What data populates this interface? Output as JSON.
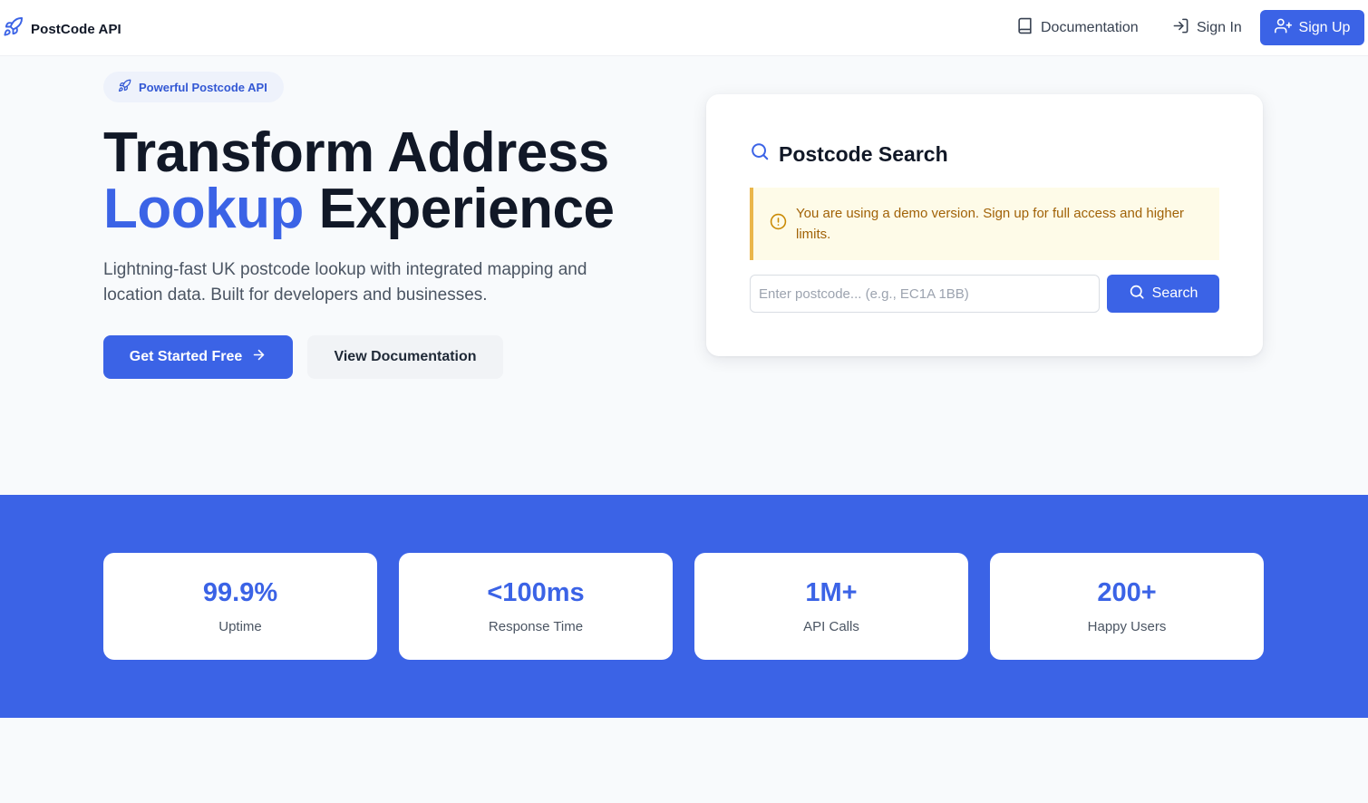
{
  "nav": {
    "brand": "PostCode API",
    "documentation": "Documentation",
    "sign_in": "Sign In",
    "sign_up": "Sign Up"
  },
  "hero": {
    "badge": "Powerful Postcode API",
    "headline_line1": "Transform Address",
    "headline_accent": "Lookup",
    "headline_rest": "Experience",
    "subtext": "Lightning-fast UK postcode lookup with integrated mapping and location data. Built for developers and businesses.",
    "primary_button": "Get Started Free",
    "secondary_button": "View Documentation"
  },
  "search_card": {
    "title": "Postcode Search",
    "alert": "You are using a demo version. Sign up for full access and higher limits.",
    "input_value": "",
    "input_placeholder": "Enter postcode... (e.g., EC1A 1BB)",
    "button": "Search"
  },
  "stats": [
    {
      "value": "99.9%",
      "label": "Uptime"
    },
    {
      "value": "<100ms",
      "label": "Response Time"
    },
    {
      "value": "1M+",
      "label": "API Calls"
    },
    {
      "value": "200+",
      "label": "Happy Users"
    }
  ],
  "colors": {
    "primary": "#3b63e6",
    "alert_bg": "#fefbe8",
    "alert_border": "#eab64a",
    "alert_text": "#a16207"
  },
  "icons": {
    "brand": "rocket-icon",
    "documentation": "book-icon",
    "sign_in": "sign-in-icon",
    "sign_up": "user-plus-icon",
    "badge": "rocket-icon",
    "primary_button": "arrow-right-icon",
    "card_title": "search-icon",
    "alert": "alert-circle-icon",
    "search_button": "search-icon"
  }
}
